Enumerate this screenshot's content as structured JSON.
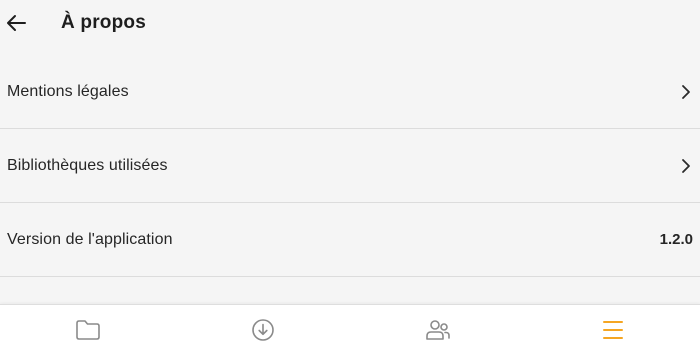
{
  "header": {
    "title": "À propos",
    "back_icon": "arrow-left-icon"
  },
  "list": {
    "items": [
      {
        "label": "Mentions légales",
        "trailing": "chevron-right-icon"
      },
      {
        "label": "Bibliothèques utilisées",
        "trailing": "chevron-right-icon"
      },
      {
        "label": "Version de l'application",
        "value": "1.2.0"
      }
    ]
  },
  "bottom_nav": {
    "items": [
      {
        "icon": "folder-icon",
        "active": false
      },
      {
        "icon": "download-circle-icon",
        "active": false
      },
      {
        "icon": "users-icon",
        "active": false
      },
      {
        "icon": "menu-icon",
        "active": true
      }
    ],
    "inactive_color": "#8a8a8a",
    "active_color": "#f5a623"
  }
}
